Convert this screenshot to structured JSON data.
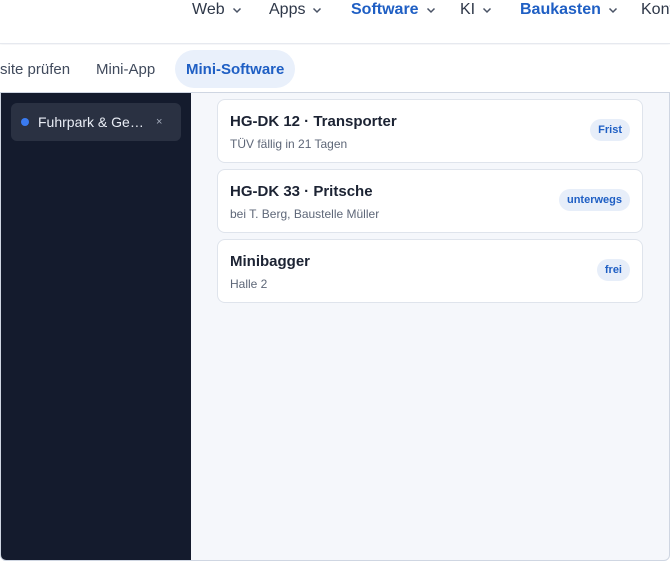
{
  "top_nav": {
    "items": [
      {
        "label": "Web",
        "accent": false
      },
      {
        "label": "Apps",
        "accent": false
      },
      {
        "label": "Software",
        "accent": true
      },
      {
        "label": "KI",
        "accent": false
      },
      {
        "label": "Baukasten",
        "accent": true
      },
      {
        "label": "Kont",
        "accent": false
      }
    ]
  },
  "sub_nav": {
    "items": [
      {
        "label": "site prüfen",
        "active": false
      },
      {
        "label": "Mini-App",
        "active": false
      },
      {
        "label": "Mini-Software",
        "active": true
      }
    ]
  },
  "sidebar": {
    "tab": {
      "label": "Fuhrpark & Geräte",
      "close": "×"
    }
  },
  "cards": [
    {
      "title": "HG-DK 12 · Transporter",
      "subtitle": "TÜV fällig in 21 Tagen",
      "badge": "Frist"
    },
    {
      "title": "HG-DK 33 · Pritsche",
      "subtitle": "bei T. Berg, Baustelle Müller",
      "badge": "unterwegs"
    },
    {
      "title": "Minibagger",
      "subtitle": "Halle 2",
      "badge": "frei"
    }
  ],
  "colors": {
    "accent": "#1f5fc4",
    "sidebar_bg": "#141b2d",
    "badge_bg": "#e7eef9"
  }
}
